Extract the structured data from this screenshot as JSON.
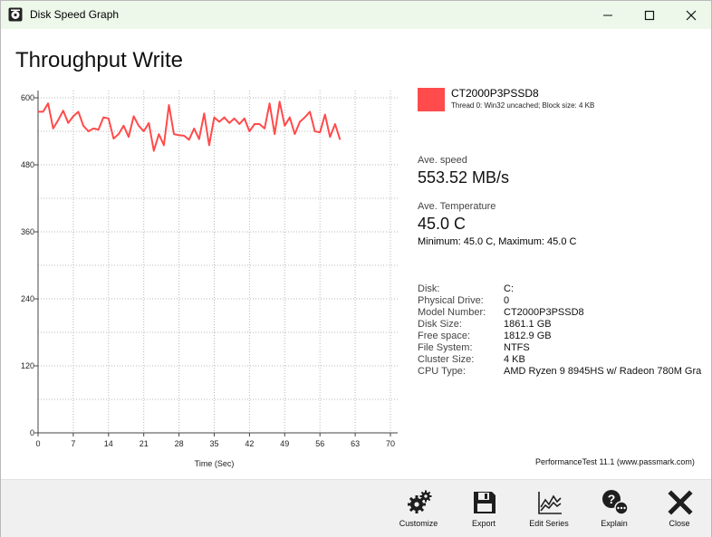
{
  "window": {
    "title": "Disk Speed Graph"
  },
  "page_title": "Throughput Write",
  "legend": {
    "name": "CT2000P3PSSD8",
    "sub": "Thread 0: Win32 uncached; Block size: 4 KB",
    "color": "#ff4b4b"
  },
  "stats": {
    "ave_speed_label": "Ave. speed",
    "ave_speed_value": "553.52 MB/s",
    "ave_temp_label": "Ave. Temperature",
    "ave_temp_value": "45.0 C",
    "minmax": "Minimum: 45.0 C, Maximum: 45.0 C"
  },
  "details": [
    {
      "label": "Disk:",
      "value": "C:"
    },
    {
      "label": "Physical Drive:",
      "value": "0"
    },
    {
      "label": "Model Number:",
      "value": "CT2000P3PSSD8"
    },
    {
      "label": "Disk Size:",
      "value": "1861.1 GB"
    },
    {
      "label": "Free space:",
      "value": "1812.9 GB"
    },
    {
      "label": "File System:",
      "value": "NTFS"
    },
    {
      "label": "Cluster Size:",
      "value": "4 KB"
    },
    {
      "label": "CPU Type:",
      "value": "AMD Ryzen 9 8945HS w/ Radeon 780M Gra"
    }
  ],
  "credit": "PerformanceTest 11.1 (www.passmark.com)",
  "toolbar": {
    "customize": "Customize",
    "export": "Export",
    "edit_series": "Edit Series",
    "explain": "Explain",
    "close": "Close"
  },
  "chart_data": {
    "type": "line",
    "title": "",
    "xlabel": "Time (Sec)",
    "ylabel": "",
    "xlim": [
      0,
      70
    ],
    "ylim": [
      0,
      600
    ],
    "x_ticks": [
      0,
      7,
      14,
      21,
      28,
      35,
      42,
      49,
      56,
      63,
      70
    ],
    "y_ticks": [
      0,
      120,
      240,
      360,
      480,
      600
    ],
    "grid": true,
    "series": [
      {
        "name": "CT2000P3PSSD8",
        "color": "#ff4b4b",
        "x": [
          0,
          1,
          2,
          3,
          4,
          5,
          6,
          7,
          8,
          9,
          10,
          11,
          12,
          13,
          14,
          15,
          16,
          17,
          18,
          19,
          20,
          21,
          22,
          23,
          24,
          25,
          26,
          27,
          28,
          29,
          30,
          31,
          32,
          33,
          34,
          35,
          36,
          37,
          38,
          39,
          40,
          41,
          42,
          43,
          44,
          45,
          46,
          47,
          48,
          49,
          50,
          51,
          52,
          53,
          54,
          55,
          56,
          57,
          58,
          59,
          60
        ],
        "y": [
          575,
          575,
          590,
          545,
          560,
          577,
          555,
          567,
          575,
          550,
          540,
          545,
          543,
          565,
          563,
          527,
          535,
          550,
          530,
          567,
          550,
          540,
          555,
          505,
          535,
          515,
          587,
          535,
          533,
          532,
          525,
          545,
          526,
          572,
          515,
          565,
          557,
          565,
          555,
          563,
          553,
          563,
          540,
          553,
          553,
          545,
          590,
          535,
          593,
          550,
          565,
          535,
          557,
          565,
          575,
          540,
          538,
          570,
          530,
          553,
          525
        ]
      }
    ]
  }
}
